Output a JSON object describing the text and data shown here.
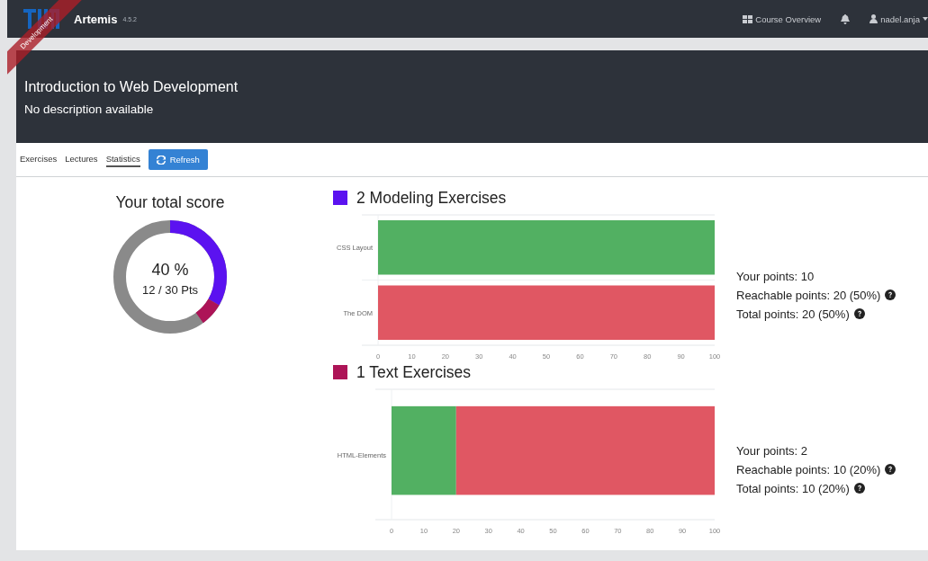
{
  "navbar": {
    "brand": "Artemis",
    "version": "4.5.2",
    "ribbon": "Development",
    "links": [
      {
        "kind": "overview",
        "label": "Course Overview"
      },
      {
        "kind": "bell"
      },
      {
        "kind": "user",
        "label": "nadel.anja"
      }
    ]
  },
  "course": {
    "title": "Introduction to Web Development",
    "description": "No description available"
  },
  "tabs": [
    {
      "label": "Exercises",
      "selected": false
    },
    {
      "label": "Lectures",
      "selected": false
    },
    {
      "label": "Statistics",
      "selected": true
    }
  ],
  "refresh_button": "Refresh",
  "score": {
    "title": "Your total score",
    "percent": "40 %",
    "points": "12 / 30 Pts",
    "segments": [
      {
        "color": "#5b12f0",
        "level": 0.333
      },
      {
        "color": "#ad1457",
        "level": 0.067
      }
    ]
  },
  "groups": [
    {
      "title": "2 Modeling Exercises",
      "color": "#5b12f0",
      "your_points": "Your points: 10",
      "reachable": "Reachable points: 20 (50%)",
      "total": "Total points: 20 (50%)",
      "chart_data": {
        "type": "bar",
        "orientation": "horizontal",
        "stacked": true,
        "categories": [
          "CSS Layout",
          "The DOM"
        ],
        "xlim": [
          0,
          100
        ],
        "xticks": [
          0,
          10,
          20,
          30,
          40,
          50,
          60,
          70,
          80,
          90,
          100
        ],
        "series": [
          {
            "color": "#52b062",
            "values": [
              100,
              0
            ]
          },
          {
            "color": "#e05763",
            "values": [
              0,
              100
            ]
          }
        ]
      }
    },
    {
      "title": "1 Text Exercises",
      "color": "#ad1457",
      "your_points": "Your points: 2",
      "reachable": "Reachable points: 10 (20%)",
      "total": "Total points: 10 (20%)",
      "chart_data": {
        "type": "bar",
        "orientation": "horizontal",
        "stacked": true,
        "categories": [
          "HTML-Elements"
        ],
        "xlim": [
          0,
          100
        ],
        "xticks": [
          0,
          10,
          20,
          30,
          40,
          50,
          60,
          70,
          80,
          90,
          100
        ],
        "series": [
          {
            "color": "#52b062",
            "values": [
              20
            ]
          },
          {
            "color": "#e05763",
            "values": [
              80
            ]
          }
        ]
      }
    }
  ]
}
